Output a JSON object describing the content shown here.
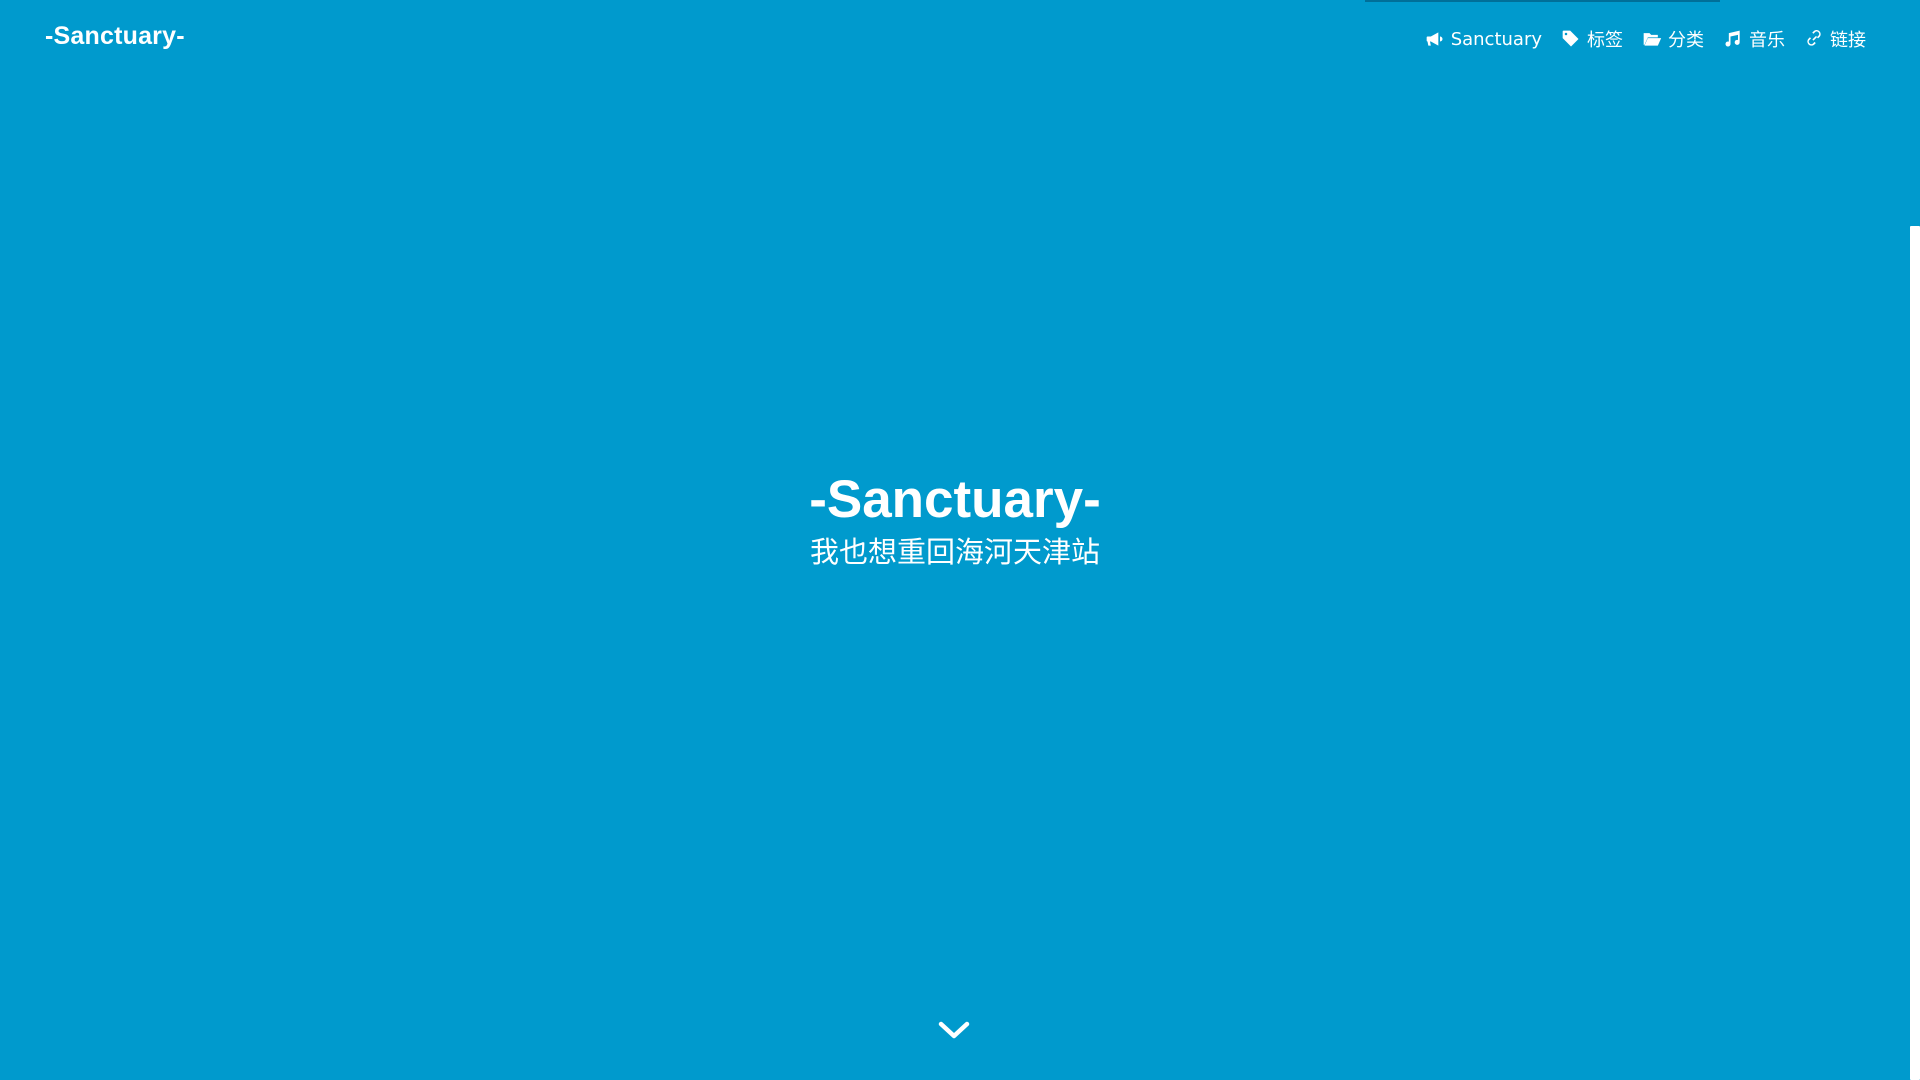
{
  "header": {
    "brand": "-Sanctuary-",
    "nav": [
      {
        "icon": "bullhorn-icon",
        "label": "Sanctuary"
      },
      {
        "icon": "tag-icon",
        "label": "标签"
      },
      {
        "icon": "folder-open-icon",
        "label": "分类"
      },
      {
        "icon": "music-icon",
        "label": "音乐"
      },
      {
        "icon": "link-icon",
        "label": "链接"
      }
    ]
  },
  "hero": {
    "title": "-Sanctuary-",
    "subtitle": "我也想重回海河天津站"
  },
  "scroll_indicator": {
    "icon": "chevron-down-icon"
  },
  "colors": {
    "background": "#009acd",
    "text": "#ffffff"
  }
}
